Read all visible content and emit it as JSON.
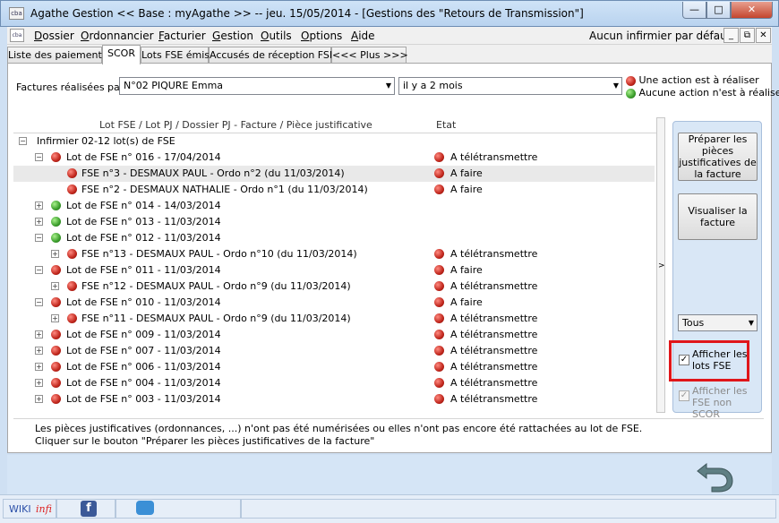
{
  "window": {
    "title": "Agathe Gestion << Base : myAgathe >>    --   jeu. 15/05/2014  -  [Gestions des \"Retours de Transmission\"]",
    "icon_label": "cba",
    "minimize_glyph": "—",
    "maximize_glyph": "□",
    "close_glyph": "✕"
  },
  "menu": {
    "items": [
      {
        "first": "D",
        "rest": "ossier"
      },
      {
        "first": "O",
        "rest": "rdonnancier"
      },
      {
        "first": "F",
        "rest": "acturier"
      },
      {
        "first": "G",
        "rest": "estion"
      },
      {
        "first": "O",
        "rest": "utils"
      },
      {
        "first": "O",
        "rest": "ptions"
      },
      {
        "first": "A",
        "rest": "ide"
      }
    ],
    "right_label": "Aucun infirmier par défaut",
    "mdi_min": "_",
    "mdi_restore": "⧉",
    "mdi_close": "✕"
  },
  "tabs": [
    {
      "label": "Liste des paiements"
    },
    {
      "label": "SCOR"
    },
    {
      "label": "Lots FSE émis"
    },
    {
      "label": "Accusés de réception FSE"
    },
    {
      "label": "<<< Plus >>>"
    }
  ],
  "filter": {
    "label": "Factures réalisées par:",
    "nurse_value": "N°02  PIQURE Emma",
    "period_value": "il y a 2 mois",
    "arrow": "▼"
  },
  "legend": {
    "red_text": "Une action est à réaliser",
    "green_text": "Aucune action n'est à réaliser",
    "red_color": "#c0261c",
    "green_color": "#3a9d2b"
  },
  "tree": {
    "col_lot": "Lot FSE / Lot PJ / Dossier PJ - Facture / Pièce justificative",
    "col_etat": "Etat",
    "root": "Infirmier 02-12 lot(s) de FSE",
    "rows": [
      {
        "text": "Lot de FSE n° 016 - 17/04/2014",
        "etat": "A télétransmettre"
      },
      {
        "text": "FSE n°3 - DESMAUX PAUL - Ordo n°2 (du 11/03/2014)",
        "etat": "A faire"
      },
      {
        "text": "FSE n°2 - DESMAUX NATHALIE - Ordo n°1 (du 11/03/2014)",
        "etat": "A faire"
      },
      {
        "text": "Lot de FSE n° 014 - 14/03/2014",
        "etat": ""
      },
      {
        "text": "Lot de FSE n° 013 - 11/03/2014",
        "etat": ""
      },
      {
        "text": "Lot de FSE n° 012 - 11/03/2014",
        "etat": ""
      },
      {
        "text": "FSE n°13 - DESMAUX PAUL - Ordo n°10 (du 11/03/2014)",
        "etat": "A télétransmettre"
      },
      {
        "text": "Lot de FSE n° 011 - 11/03/2014",
        "etat": "A faire"
      },
      {
        "text": "FSE n°12 - DESMAUX PAUL - Ordo n°9 (du 11/03/2014)",
        "etat": "A télétransmettre"
      },
      {
        "text": "Lot de FSE n° 010 - 11/03/2014",
        "etat": "A faire"
      },
      {
        "text": "FSE n°11 - DESMAUX PAUL - Ordo n°9 (du 11/03/2014)",
        "etat": "A télétransmettre"
      },
      {
        "text": "Lot de FSE n° 009 - 11/03/2014",
        "etat": "A télétransmettre"
      },
      {
        "text": "Lot de FSE n° 007 - 11/03/2014",
        "etat": "A télétransmettre"
      },
      {
        "text": "Lot de FSE n° 006 - 11/03/2014",
        "etat": "A télétransmettre"
      },
      {
        "text": "Lot de FSE n° 004 - 11/03/2014",
        "etat": "A télétransmettre"
      },
      {
        "text": "Lot de FSE n° 003 - 11/03/2014",
        "etat": "A télétransmettre"
      }
    ],
    "expand_glyph": "+",
    "collapse_glyph": "−",
    "scroll_glyph": ">"
  },
  "side": {
    "prepare_button": "Préparer les pièces justificatives de la facture",
    "view_button": "Visualiser la facture",
    "type_value": "Tous",
    "show_lots_label": "Afficher les lots FSE",
    "show_non_scor_label": "Afficher les FSE non SCOR",
    "check_glyph": "✓"
  },
  "info": {
    "line1": "Les pièces justificatives (ordonnances, ...) n'ont pas été numérisées ou elles n'ont pas encore été rattachées au lot de FSE.",
    "line2": "Cliquer sur le bouton \"Préparer les pièces justificatives de la facture\""
  },
  "status": {
    "wiki": "WIKI",
    "infi": "infi",
    "facebook_glyph": "f"
  }
}
